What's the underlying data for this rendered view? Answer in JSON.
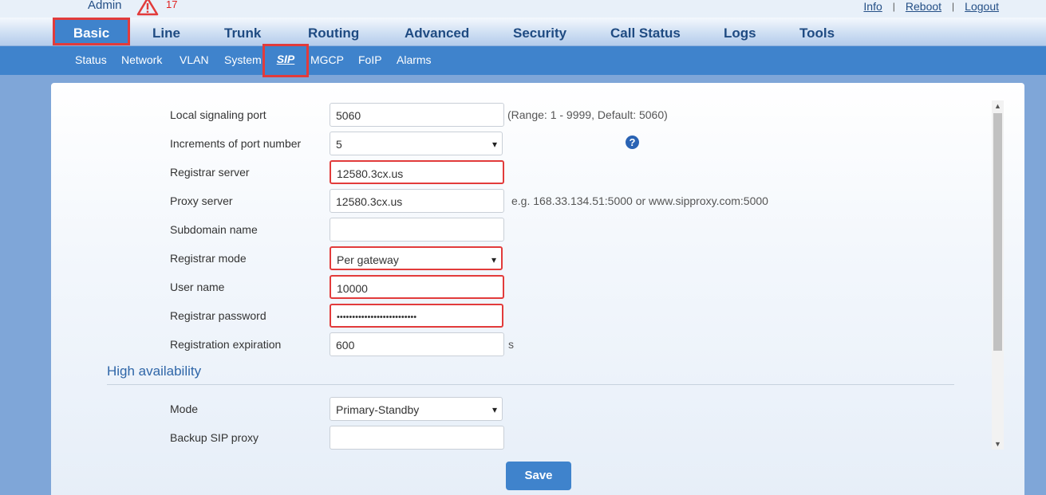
{
  "header": {
    "user": "Admin",
    "alarm_count": "17",
    "links": {
      "info": "Info",
      "reboot": "Reboot",
      "logout": "Logout"
    },
    "separator": "|"
  },
  "main_nav": {
    "items": [
      "Basic",
      "Line",
      "Trunk",
      "Routing",
      "Advanced",
      "Security",
      "Call Status",
      "Logs",
      "Tools"
    ],
    "active": "Basic"
  },
  "sub_nav": {
    "items": [
      "Status",
      "Network",
      "VLAN",
      "System",
      "SIP",
      "MGCP",
      "FoIP",
      "Alarms"
    ],
    "active": "SIP"
  },
  "form": {
    "local_port": {
      "label": "Local signaling port",
      "value": "5060",
      "hint": "(Range: 1 - 9999, Default: 5060)"
    },
    "increments": {
      "label": "Increments of port number",
      "value": "5",
      "help": "?"
    },
    "registrar_server": {
      "label": "Registrar server",
      "value": "12580.3cx.us"
    },
    "proxy_server": {
      "label": "Proxy server",
      "value": "12580.3cx.us",
      "hint": "e.g. 168.33.134.51:5000 or www.sipproxy.com:5000"
    },
    "subdomain": {
      "label": "Subdomain name",
      "value": ""
    },
    "registrar_mode": {
      "label": "Registrar mode",
      "value": "Per gateway"
    },
    "user_name": {
      "label": "User name",
      "value": "10000"
    },
    "registrar_password": {
      "label": "Registrar password",
      "value": "••••••••••••••••••••••••••"
    },
    "registration_expiration": {
      "label": "Registration expiration",
      "value": "600",
      "unit": "s"
    }
  },
  "high_availability": {
    "title": "High availability",
    "mode": {
      "label": "Mode",
      "value": "Primary-Standby"
    },
    "backup_proxy": {
      "label": "Backup SIP proxy",
      "value": ""
    }
  },
  "actions": {
    "save": "Save"
  },
  "colors": {
    "accent": "#3f83cc",
    "highlight": "#e23b3b",
    "nav_text": "#1f4b82",
    "warning": "#e02020"
  }
}
